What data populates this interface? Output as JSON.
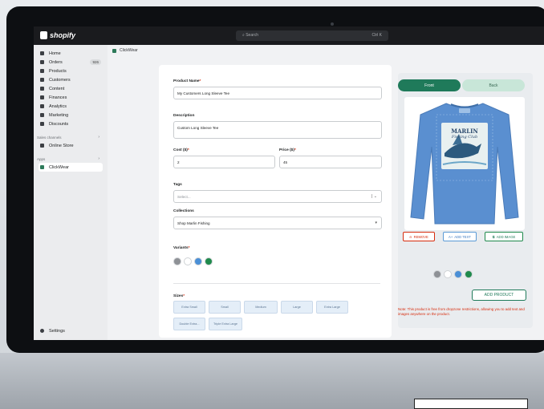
{
  "app": {
    "logo": "shopify"
  },
  "search": {
    "placeholder": "Search",
    "shortcut": "Ctrl K"
  },
  "sidebar": {
    "items": [
      {
        "label": "Home",
        "icon": "home-icon"
      },
      {
        "label": "Orders",
        "icon": "orders-icon",
        "badge": "926"
      },
      {
        "label": "Products",
        "icon": "tag-icon"
      },
      {
        "label": "Customers",
        "icon": "person-icon"
      },
      {
        "label": "Content",
        "icon": "content-icon"
      },
      {
        "label": "Finances",
        "icon": "bank-icon"
      },
      {
        "label": "Analytics",
        "icon": "chart-icon"
      },
      {
        "label": "Marketing",
        "icon": "target-icon"
      },
      {
        "label": "Discounts",
        "icon": "discount-icon"
      }
    ],
    "sales_channels_label": "Sales channels",
    "online_store": "Online Store",
    "apps_label": "Apps",
    "app_item": "ClickWear",
    "settings": "Settings"
  },
  "breadcrumb": {
    "label": "ClickWear"
  },
  "form": {
    "product_name_label": "Product Name",
    "product_name_value": "My Customers Long Sleeve Tee",
    "description_label": "Description",
    "description_value": "Custom Long Sleeve Tee",
    "cost_label": "Cost ($)",
    "cost_value": "2",
    "price_label": "Price ($)",
    "price_value": "45",
    "tags_label": "Tags",
    "tags_placeholder": "Select...",
    "collections_label": "Collections",
    "collections_value": "Shop Marlin Fishing",
    "variants_label": "Variants",
    "variant_colors": [
      "#8e9196",
      "#ffffff",
      "#4a8fd6",
      "#1f8a4c"
    ],
    "sizes_label": "Sizes",
    "sizes": [
      "Extra Small",
      "Small",
      "Medium",
      "Large",
      "Extra Large",
      "Double Extra...",
      "Triple Extra Large"
    ]
  },
  "preview": {
    "front_tab": "Front",
    "back_tab": "Back",
    "remove_button": "REMOVE",
    "add_text_button": "ADD TEXT",
    "add_image_button": "ADD IMAGE",
    "shirt_colors": [
      "#8e9196",
      "#ffffff",
      "#4a8fd6",
      "#1f8a4c"
    ],
    "add_product_button": "ADD PRODUCT",
    "note": "Note: This product is free from dropzone restrictions, allowing you to add text and images anywhere on the product.",
    "shirt_print_text": [
      "MARLIN",
      "Fishing Club"
    ]
  }
}
